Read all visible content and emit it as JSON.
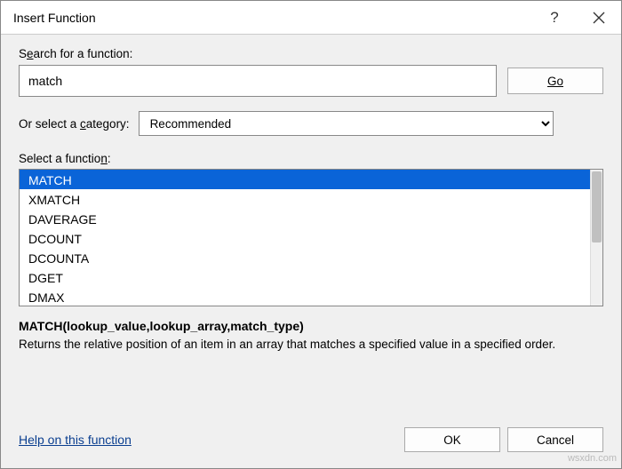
{
  "titlebar": {
    "title": "Insert Function"
  },
  "search": {
    "label_pre": "S",
    "label_u": "e",
    "label_post": "arch for a function:",
    "value": "match",
    "go_pre": "",
    "go_u": "G",
    "go_post": "o"
  },
  "category": {
    "label_pre": "Or select a ",
    "label_u": "c",
    "label_post": "ategory:",
    "selected": "Recommended"
  },
  "functions": {
    "label_pre": "Select a functio",
    "label_u": "n",
    "label_post": ":",
    "items": [
      "MATCH",
      "XMATCH",
      "DAVERAGE",
      "DCOUNT",
      "DCOUNTA",
      "DGET",
      "DMAX"
    ],
    "selected_index": 0
  },
  "description": {
    "signature": "MATCH(lookup_value,lookup_array,match_type)",
    "text": "Returns the relative position of an item in an array that matches a specified value in a specified order."
  },
  "footer": {
    "help_link": "Help on this function",
    "ok": "OK",
    "cancel": "Cancel"
  },
  "watermark": "wsxdn.com"
}
